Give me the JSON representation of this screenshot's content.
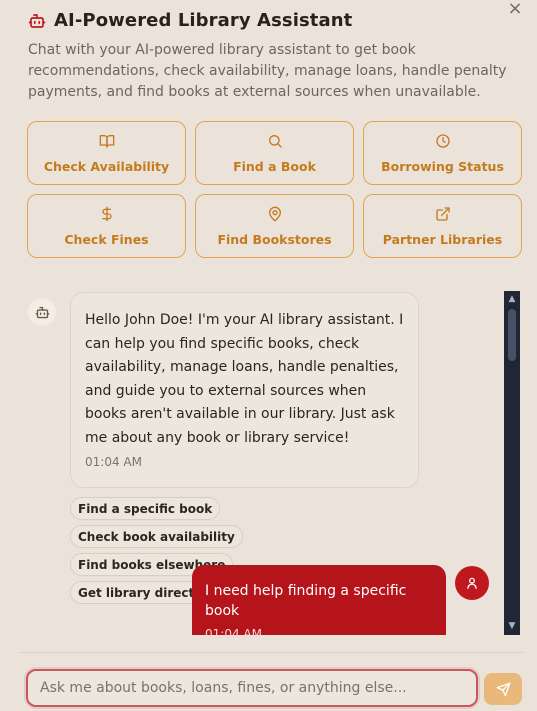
{
  "header": {
    "title": "AI-Powered Library Assistant",
    "description": "Chat with your AI-powered library assistant to get book recommendations, check availability, manage loans, handle penalty payments, and find books at external sources when unavailable.",
    "close_label": "×"
  },
  "actions": [
    {
      "label": "Check Availability",
      "icon": "book-open-icon"
    },
    {
      "label": "Find a Book",
      "icon": "search-icon"
    },
    {
      "label": "Borrowing Status",
      "icon": "clock-icon"
    },
    {
      "label": "Check Fines",
      "icon": "dollar-icon"
    },
    {
      "label": "Find Bookstores",
      "icon": "map-pin-icon"
    },
    {
      "label": "Partner Libraries",
      "icon": "external-link-icon"
    }
  ],
  "messages": {
    "bot": {
      "text": "Hello John Doe! I'm your AI library assistant. I can help you find specific books, check availability, manage loans, handle penalties, and guide you to external sources when books aren't available in our library. Just ask me about any book or library service!",
      "time": "01:04 AM"
    },
    "user": {
      "text": "I need help finding a specific book",
      "time": "01:04 AM"
    }
  },
  "suggestions": [
    "Find a specific book",
    "Check book availability",
    "Find books elsewhere",
    "Get library directions"
  ],
  "input": {
    "placeholder": "Ask me about books, loans, fines, or anything else...",
    "value": ""
  },
  "colors": {
    "accent": "#c47b1d",
    "accent_border": "#e2a452",
    "brand_red": "#b5141b",
    "send_button": "#e9b97c"
  }
}
